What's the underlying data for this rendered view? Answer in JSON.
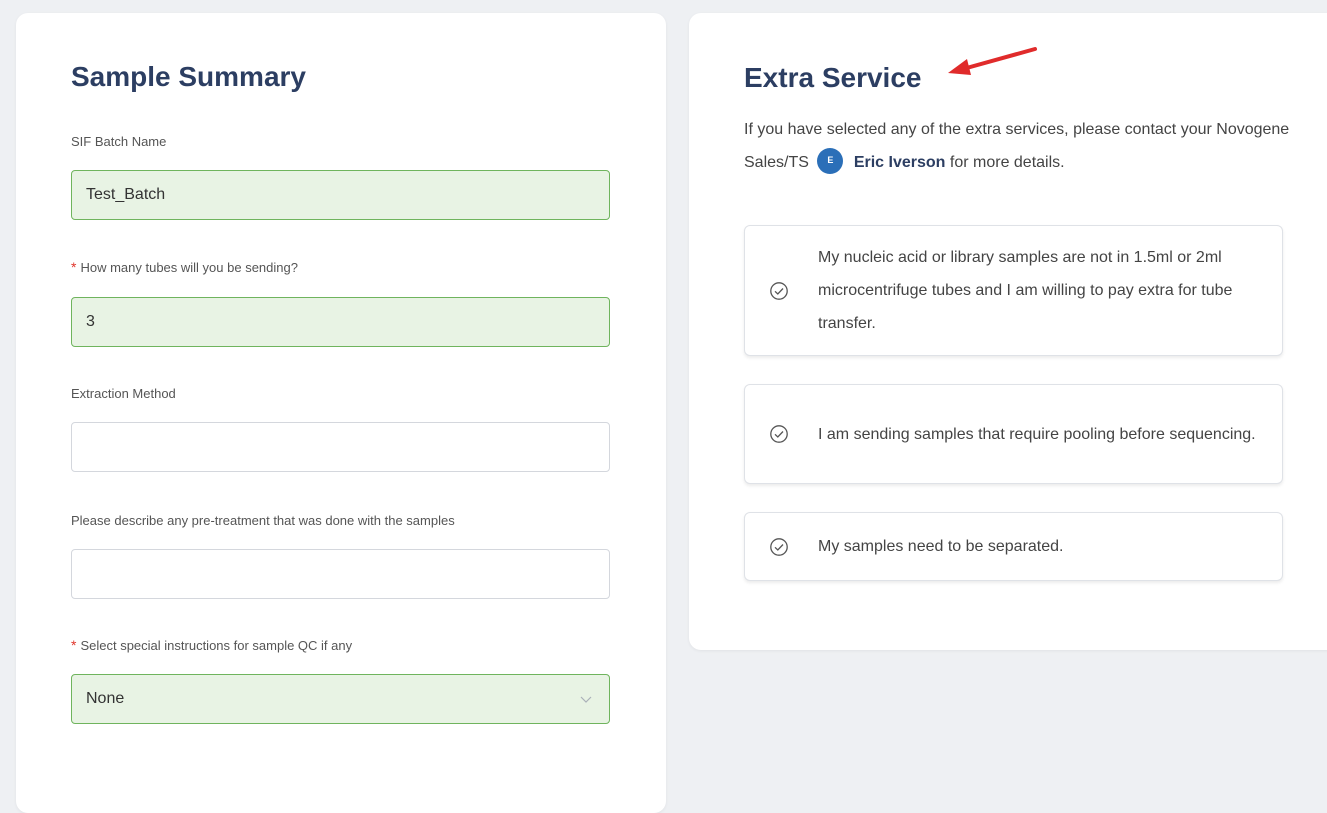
{
  "sample_summary": {
    "title": "Sample Summary",
    "batch_name": {
      "label": "SIF Batch Name",
      "value": "Test_Batch"
    },
    "tubes": {
      "required_mark": "*",
      "label": "How many tubes will you be sending?",
      "value": "3"
    },
    "extraction": {
      "label": "Extraction Method",
      "value": ""
    },
    "pretreatment": {
      "label": "Please describe any pre-treatment that was done with the samples",
      "value": ""
    },
    "qc": {
      "required_mark": "*",
      "label": "Select special instructions for sample QC if any",
      "selected": "None"
    }
  },
  "extra_service": {
    "title": "Extra Service",
    "desc_part1": "If you have selected any of the extra services, please contact your Novogene Sales/TS",
    "avatar_initial": "E",
    "contact_name": "Eric Iverson",
    "desc_part2": "for more details.",
    "options": [
      "My nucleic acid or library samples are not in 1.5ml or 2ml microcentrifuge tubes and I am willing to pay extra for tube transfer.",
      "I am sending samples that require pooling before sequencing.",
      "My samples need to be separated."
    ]
  },
  "colors": {
    "title": "#2c3e62",
    "filled_bg": "#e8f3e4",
    "filled_border": "#6fb45d",
    "required": "#e0352b",
    "avatar": "#2b6fb8",
    "annotation_arrow": "#e02b2b"
  }
}
